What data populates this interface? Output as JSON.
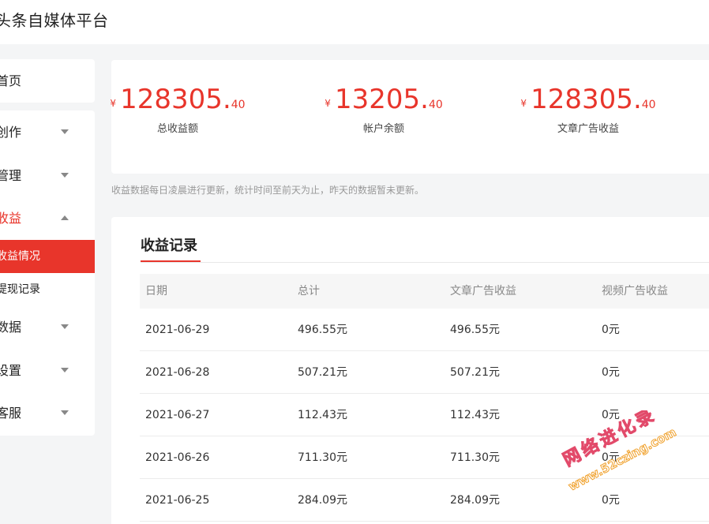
{
  "header": {
    "title": "头条自媒体平台"
  },
  "sidebar": {
    "home": "首页",
    "items": [
      {
        "label": "创作",
        "caret": "down"
      },
      {
        "label": "管理",
        "caret": "down"
      },
      {
        "label": "收益",
        "caret": "up"
      },
      {
        "label": "数据",
        "caret": "down"
      },
      {
        "label": "设置",
        "caret": "down"
      },
      {
        "label": "客服",
        "caret": "down"
      }
    ],
    "sub_items": [
      {
        "label": "收益情况",
        "selected": true
      },
      {
        "label": "提现记录",
        "selected": false
      }
    ]
  },
  "stats": [
    {
      "currency": "¥",
      "integer": "128305",
      "dot": ".",
      "decimal": "40",
      "caption": "总收益额"
    },
    {
      "currency": "¥",
      "integer": "13205",
      "dot": ".",
      "decimal": "40",
      "caption": "帐户余额"
    },
    {
      "currency": "¥",
      "integer": "128305",
      "dot": ".",
      "decimal": "40",
      "caption": "文章广告收益"
    }
  ],
  "notice": "收益数据每日凌晨进行更新，统计时间至前天为止，昨天的数据暂未更新。",
  "records": {
    "title": "收益记录",
    "columns": [
      "日期",
      "总计",
      "文章广告收益",
      "视频广告收益"
    ],
    "rows": [
      [
        "2021-06-29",
        "496.55元",
        "496.55元",
        "0元"
      ],
      [
        "2021-06-28",
        "507.21元",
        "507.21元",
        "0元"
      ],
      [
        "2021-06-27",
        "112.43元",
        "112.43元",
        "0元"
      ],
      [
        "2021-06-26",
        "711.30元",
        "711.30元",
        "0元"
      ],
      [
        "2021-06-25",
        "284.09元",
        "284.09元",
        "0元"
      ]
    ]
  },
  "watermark": {
    "line1": "网络进化录",
    "line2": "www.52czing.com"
  },
  "colors": {
    "accent": "#e8352b",
    "background": "#f4f5f6",
    "card": "#ffffff",
    "muted": "#999999"
  }
}
